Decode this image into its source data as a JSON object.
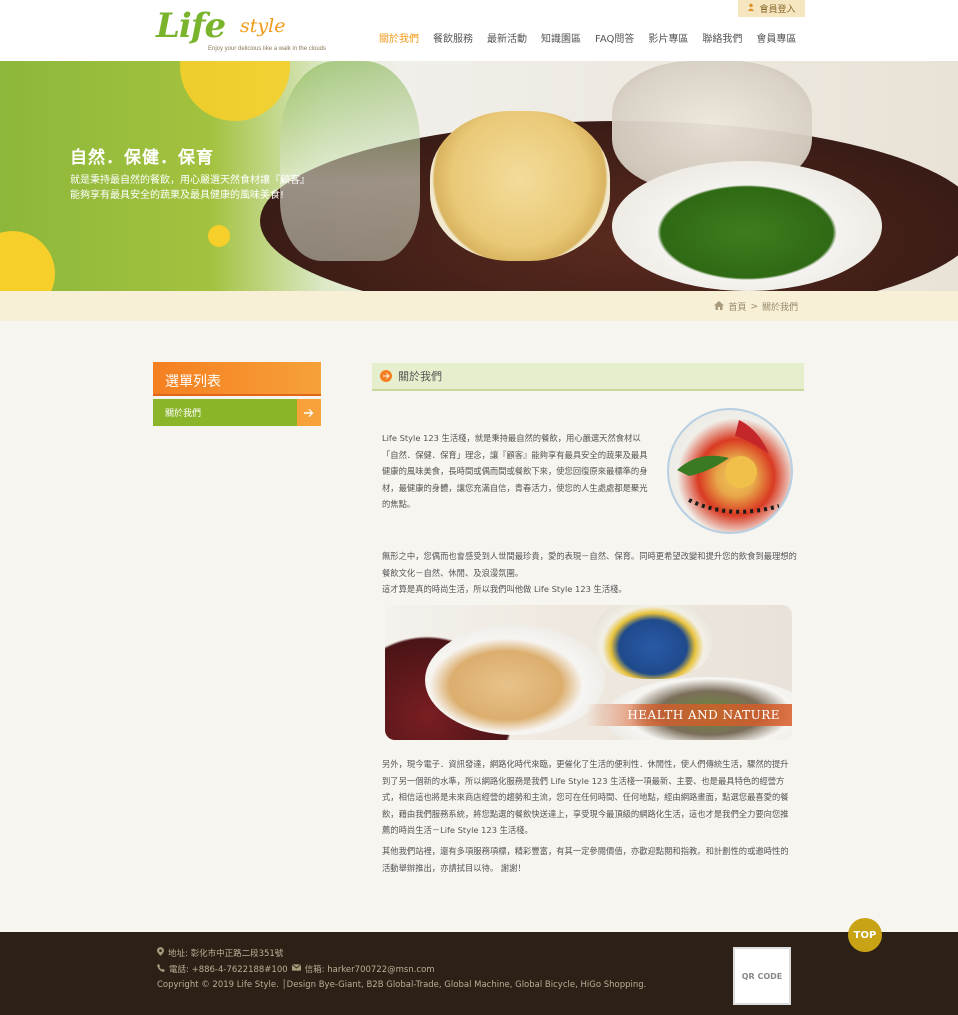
{
  "header": {
    "logo_main": "Life",
    "logo_style": "style",
    "logo_tagline": "Enjoy your delicious like a walk in the clouds",
    "member_login": "會員登入"
  },
  "nav": {
    "items": [
      {
        "label": "關於我們"
      },
      {
        "label": "餐飲服務"
      },
      {
        "label": "最新活動"
      },
      {
        "label": "知識園區"
      },
      {
        "label": "FAQ問答"
      },
      {
        "label": "影片專區"
      },
      {
        "label": "聯絡我們"
      },
      {
        "label": "會員專區"
      }
    ]
  },
  "banner": {
    "title": "自然．保健．保育",
    "text": "就是秉持最自然的餐飲，用心嚴選天然食材讓『顧客』能夠享有最具安全的蔬果及最具健康的風味美食!"
  },
  "breadcrumb": {
    "home": "首頁",
    "separator": ">",
    "current": "關於我們"
  },
  "sidebar": {
    "title": "選單列表",
    "items": [
      {
        "label": "關於我們"
      }
    ]
  },
  "main": {
    "title": "關於我們",
    "para1": "Life Style 123 生活棧，就是秉持最自然的餐飲，用心嚴選天然食材以「自然．保健．保育」理念，讓『顧客』能夠享有最具安全的蔬果及最具健康的風味美食，長時間或偶而間或餐飲下來，使您回復原來最標準的身材，最健康的身體，讓您充滿自信，青春活力，使您的人生處處都是聚光的焦點。",
    "para2_line1": "無形之中，您偶而也會感受到人世間最珍貴，愛的表現－自然、保育。同時更希望改變和提升您的飲食到最理想的餐飲文化－自然、休閒、及浪漫氛圍。",
    "para2_line2": "這才算是真的時尚生活，所以我們叫他做 Life Style 123 生活棧。",
    "image_caption": "HEALTH AND NATURE",
    "para3": "另外，現今電子．資訊發達，網路化時代來臨，更催化了生活的便利性．休閒性，使人們傳統生活，驟然的提升到了另一個新的水準，所以網路化服務是我們 Life Style 123 生活棧一項最新、主要、也是最具特色的經營方式，相信這也將是未來商店經營的趨勢和主流，您可在任何時間、任何地點，經由網路畫面，點選您最喜愛的餐飲，藉由我們服務系統，將您點選的餐飲快送達上，享受現今最頂級的網路化生活，這也才是我們全力要向您推薦的時尚生活－Life Style 123 生活棧。",
    "para4": "其他我們站裡，還有多項服務項標，精彩豐富，有其一定參閱價值，亦歡迎點閱和指教。和計劃性的或邀時性的活動舉辦推出，亦請拭目以待。 謝謝！"
  },
  "footer": {
    "address": "地址: 彰化市中正路二段351號",
    "phone": "電話: +886-4-7622188#100",
    "email": "信箱: harker700722@msn.com",
    "copyright": "Copyright © 2019 Life Style. │Design Bye-Giant, B2B Global-Trade, Global Machine, Global Bicycle, HiGo Shopping.",
    "qr_label": "QR CODE"
  },
  "top_button": "TOP",
  "icons": {
    "user": "user-icon",
    "home": "home-icon",
    "arrow": "arrow-right-icon",
    "pin": "map-pin-icon",
    "phone": "phone-icon",
    "mail": "mail-icon"
  },
  "colors": {
    "accent_orange": "#f29a1a",
    "brand_green": "#8bb529",
    "footer_bg": "#2c2017"
  }
}
